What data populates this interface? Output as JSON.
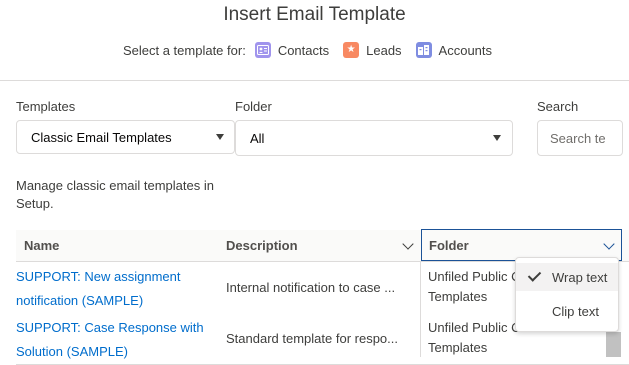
{
  "modal": {
    "title": "Insert Email Template"
  },
  "select_for": {
    "label": "Select a template for:",
    "objects": [
      {
        "label": "Contacts",
        "icon": "contact-card-icon",
        "color": "#a094ed"
      },
      {
        "label": "Leads",
        "icon": "star-icon",
        "color": "#f88962"
      },
      {
        "label": "Accounts",
        "icon": "building-icon",
        "color": "#7f8de1"
      }
    ]
  },
  "filters": {
    "templates_label": "Templates",
    "templates_value": "Classic Email Templates",
    "folder_label": "Folder",
    "folder_value": "All",
    "search_label": "Search",
    "search_placeholder": "Search te"
  },
  "manage_text": "Manage classic email templates in Setup.",
  "table": {
    "columns": [
      "Name",
      "Description",
      "Folder"
    ],
    "rows": [
      {
        "name": "SUPPORT: New assignment notification (SAMPLE)",
        "description": "Internal notification to case ...",
        "folder": "Unfiled Public Classic Email Templates"
      },
      {
        "name": "SUPPORT: Case Response with Solution (SAMPLE)",
        "description": "Standard template for respo...",
        "folder": "Unfiled Public Classic Email Templates"
      }
    ]
  },
  "column_menu": {
    "items": [
      {
        "label": "Wrap text",
        "checked": true
      },
      {
        "label": "Clip text",
        "checked": false
      }
    ]
  },
  "colors": {
    "link": "#006dcc",
    "focus_border": "#1b5297",
    "border": "#dddbda",
    "header_bg": "#fafaf9"
  }
}
